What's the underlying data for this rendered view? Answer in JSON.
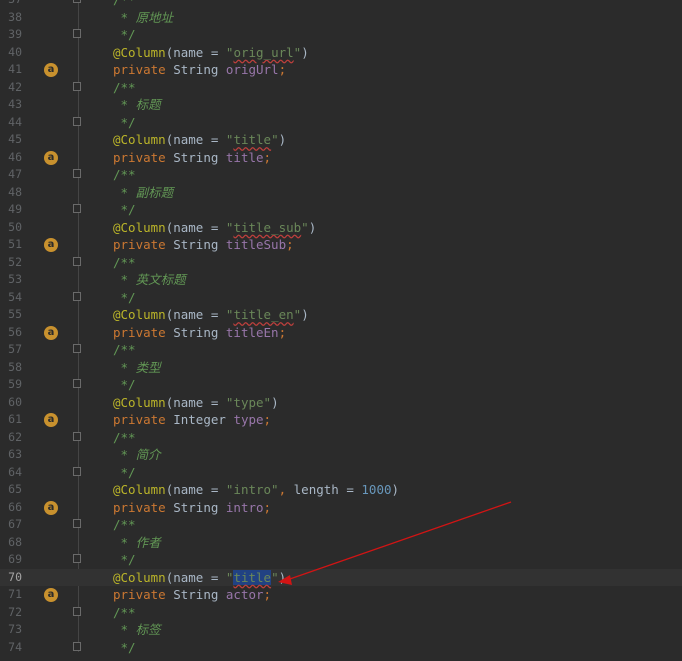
{
  "editor": {
    "current_line": 70,
    "selection": {
      "line": 70,
      "text": "title"
    },
    "colors": {
      "background": "#2b2b2b",
      "comment": "#629755",
      "annotation": "#bbb529",
      "keyword": "#cc7832",
      "string": "#6a8759",
      "field": "#9876aa",
      "number": "#6897bb",
      "arrow": "#d21414"
    },
    "gutter_icon": {
      "name": "bean-field-icon",
      "glyph": "a"
    },
    "annotation_arrow": {
      "from_line": 65,
      "to_line": 70,
      "color": "#d21414"
    },
    "lines": [
      {
        "num": "37",
        "fold": true,
        "tokens": [
          {
            "t": "/**",
            "c": "comment"
          }
        ]
      },
      {
        "num": "38",
        "fold": false,
        "tokens": [
          {
            "t": " * ",
            "c": "comment"
          },
          {
            "t": "原地址",
            "c": "comment-i"
          }
        ]
      },
      {
        "num": "39",
        "fold": true,
        "tokens": [
          {
            "t": " */",
            "c": "comment"
          }
        ]
      },
      {
        "num": "40",
        "fold": false,
        "tokens": [
          {
            "t": "@Column",
            "c": "anno"
          },
          {
            "t": "(name = ",
            "c": "plain"
          },
          {
            "t": "\"",
            "c": "str"
          },
          {
            "t": "orig_url",
            "c": "str-typo"
          },
          {
            "t": "\"",
            "c": "str"
          },
          {
            "t": ")",
            "c": "plain"
          }
        ]
      },
      {
        "num": "41",
        "icon": true,
        "tokens": [
          {
            "t": "private ",
            "c": "kw"
          },
          {
            "t": "String ",
            "c": "plain"
          },
          {
            "t": "origUrl",
            "c": "field"
          },
          {
            "t": ";",
            "c": "kw"
          }
        ]
      },
      {
        "num": "42",
        "fold": true,
        "tokens": [
          {
            "t": "/**",
            "c": "comment"
          }
        ]
      },
      {
        "num": "43",
        "fold": false,
        "tokens": [
          {
            "t": " * ",
            "c": "comment"
          },
          {
            "t": "标题",
            "c": "comment-i"
          }
        ]
      },
      {
        "num": "44",
        "fold": true,
        "tokens": [
          {
            "t": " */",
            "c": "comment"
          }
        ]
      },
      {
        "num": "45",
        "fold": false,
        "tokens": [
          {
            "t": "@Column",
            "c": "anno"
          },
          {
            "t": "(name = ",
            "c": "plain"
          },
          {
            "t": "\"",
            "c": "str"
          },
          {
            "t": "title",
            "c": "str-typo"
          },
          {
            "t": "\"",
            "c": "str"
          },
          {
            "t": ")",
            "c": "plain"
          }
        ]
      },
      {
        "num": "46",
        "icon": true,
        "tokens": [
          {
            "t": "private ",
            "c": "kw"
          },
          {
            "t": "String ",
            "c": "plain"
          },
          {
            "t": "title",
            "c": "field"
          },
          {
            "t": ";",
            "c": "kw"
          }
        ]
      },
      {
        "num": "47",
        "fold": true,
        "tokens": [
          {
            "t": "/**",
            "c": "comment"
          }
        ]
      },
      {
        "num": "48",
        "fold": false,
        "tokens": [
          {
            "t": " * ",
            "c": "comment"
          },
          {
            "t": "副标题",
            "c": "comment-i"
          }
        ]
      },
      {
        "num": "49",
        "fold": true,
        "tokens": [
          {
            "t": " */",
            "c": "comment"
          }
        ]
      },
      {
        "num": "50",
        "fold": false,
        "tokens": [
          {
            "t": "@Column",
            "c": "anno"
          },
          {
            "t": "(name = ",
            "c": "plain"
          },
          {
            "t": "\"",
            "c": "str"
          },
          {
            "t": "title_sub",
            "c": "str-typo"
          },
          {
            "t": "\"",
            "c": "str"
          },
          {
            "t": ")",
            "c": "plain"
          }
        ]
      },
      {
        "num": "51",
        "icon": true,
        "tokens": [
          {
            "t": "private ",
            "c": "kw"
          },
          {
            "t": "String ",
            "c": "plain"
          },
          {
            "t": "titleSub",
            "c": "field"
          },
          {
            "t": ";",
            "c": "kw"
          }
        ]
      },
      {
        "num": "52",
        "fold": true,
        "tokens": [
          {
            "t": "/**",
            "c": "comment"
          }
        ]
      },
      {
        "num": "53",
        "fold": false,
        "tokens": [
          {
            "t": " * ",
            "c": "comment"
          },
          {
            "t": "英文标题",
            "c": "comment-i"
          }
        ]
      },
      {
        "num": "54",
        "fold": true,
        "tokens": [
          {
            "t": " */",
            "c": "comment"
          }
        ]
      },
      {
        "num": "55",
        "fold": false,
        "tokens": [
          {
            "t": "@Column",
            "c": "anno"
          },
          {
            "t": "(name = ",
            "c": "plain"
          },
          {
            "t": "\"",
            "c": "str"
          },
          {
            "t": "title_en",
            "c": "str-typo"
          },
          {
            "t": "\"",
            "c": "str"
          },
          {
            "t": ")",
            "c": "plain"
          }
        ]
      },
      {
        "num": "56",
        "icon": true,
        "tokens": [
          {
            "t": "private ",
            "c": "kw"
          },
          {
            "t": "String ",
            "c": "plain"
          },
          {
            "t": "titleEn",
            "c": "field"
          },
          {
            "t": ";",
            "c": "kw"
          }
        ]
      },
      {
        "num": "57",
        "fold": true,
        "tokens": [
          {
            "t": "/**",
            "c": "comment"
          }
        ]
      },
      {
        "num": "58",
        "fold": false,
        "tokens": [
          {
            "t": " * ",
            "c": "comment"
          },
          {
            "t": "类型",
            "c": "comment-i"
          }
        ]
      },
      {
        "num": "59",
        "fold": true,
        "tokens": [
          {
            "t": " */",
            "c": "comment"
          }
        ]
      },
      {
        "num": "60",
        "fold": false,
        "tokens": [
          {
            "t": "@Column",
            "c": "anno"
          },
          {
            "t": "(name = ",
            "c": "plain"
          },
          {
            "t": "\"type\"",
            "c": "str"
          },
          {
            "t": ")",
            "c": "plain"
          }
        ]
      },
      {
        "num": "61",
        "icon": true,
        "tokens": [
          {
            "t": "private ",
            "c": "kw"
          },
          {
            "t": "Integer ",
            "c": "plain"
          },
          {
            "t": "type",
            "c": "field"
          },
          {
            "t": ";",
            "c": "kw"
          }
        ]
      },
      {
        "num": "62",
        "fold": true,
        "tokens": [
          {
            "t": "/**",
            "c": "comment"
          }
        ]
      },
      {
        "num": "63",
        "fold": false,
        "tokens": [
          {
            "t": " * ",
            "c": "comment"
          },
          {
            "t": "简介",
            "c": "comment-i"
          }
        ]
      },
      {
        "num": "64",
        "fold": true,
        "tokens": [
          {
            "t": " */",
            "c": "comment"
          }
        ]
      },
      {
        "num": "65",
        "fold": false,
        "tokens": [
          {
            "t": "@Column",
            "c": "anno"
          },
          {
            "t": "(name = ",
            "c": "plain"
          },
          {
            "t": "\"intro\"",
            "c": "str"
          },
          {
            "t": ", ",
            "c": "kw"
          },
          {
            "t": "length = ",
            "c": "plain"
          },
          {
            "t": "1000",
            "c": "num"
          },
          {
            "t": ")",
            "c": "plain"
          }
        ]
      },
      {
        "num": "66",
        "icon": true,
        "tokens": [
          {
            "t": "private ",
            "c": "kw"
          },
          {
            "t": "String ",
            "c": "plain"
          },
          {
            "t": "intro",
            "c": "field"
          },
          {
            "t": ";",
            "c": "kw"
          }
        ]
      },
      {
        "num": "67",
        "fold": true,
        "tokens": [
          {
            "t": "/**",
            "c": "comment"
          }
        ]
      },
      {
        "num": "68",
        "fold": false,
        "tokens": [
          {
            "t": " * ",
            "c": "comment"
          },
          {
            "t": "作者",
            "c": "comment-i"
          }
        ]
      },
      {
        "num": "69",
        "fold": true,
        "tokens": [
          {
            "t": " */",
            "c": "comment"
          }
        ]
      },
      {
        "num": "70",
        "fold": false,
        "tokens": [
          {
            "t": "@Column",
            "c": "anno"
          },
          {
            "t": "(name = ",
            "c": "plain"
          },
          {
            "t": "\"",
            "c": "str"
          },
          {
            "t": "title",
            "c": "str-sel"
          },
          {
            "t": "\"",
            "c": "str"
          },
          {
            "t": ")",
            "c": "plain"
          }
        ]
      },
      {
        "num": "71",
        "icon": true,
        "tokens": [
          {
            "t": "private ",
            "c": "kw"
          },
          {
            "t": "String ",
            "c": "plain"
          },
          {
            "t": "actor",
            "c": "field"
          },
          {
            "t": ";",
            "c": "kw"
          }
        ]
      },
      {
        "num": "72",
        "fold": true,
        "tokens": [
          {
            "t": "/**",
            "c": "comment"
          }
        ]
      },
      {
        "num": "73",
        "fold": false,
        "tokens": [
          {
            "t": " * ",
            "c": "comment"
          },
          {
            "t": "标签",
            "c": "comment-i"
          }
        ]
      },
      {
        "num": "74",
        "fold": true,
        "tokens": [
          {
            "t": " */",
            "c": "comment"
          }
        ]
      }
    ]
  }
}
